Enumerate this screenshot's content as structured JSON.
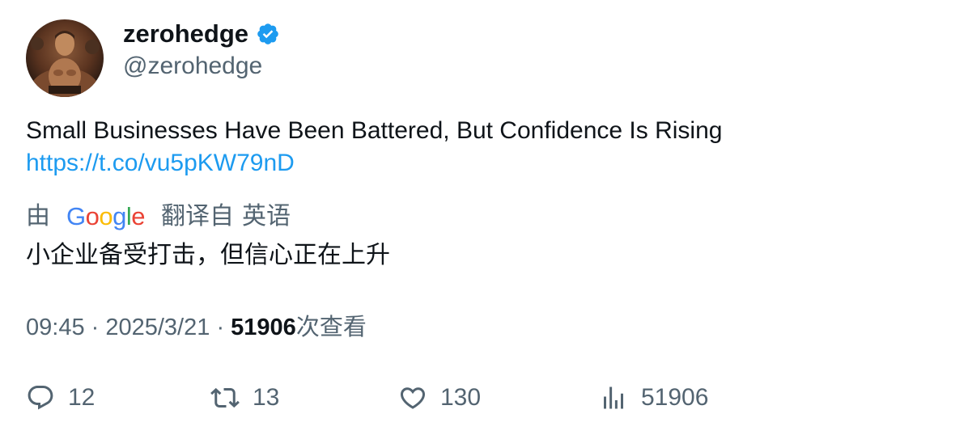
{
  "author": {
    "display_name": "zerohedge",
    "handle": "@zerohedge",
    "verified_icon": "verified-badge-icon",
    "verified_color": "#1d9bf0"
  },
  "tweet": {
    "text": "Small Businesses Have Been Battered, But Confidence Is Rising",
    "link": "https://t.co/vu5pKW79nD"
  },
  "translation": {
    "by_label": "由",
    "provider": "Google",
    "from_label": "翻译自",
    "language": "英语",
    "translated_text": "小企业备受打击，但信心正在上升"
  },
  "meta": {
    "time": "09:45",
    "separator": "·",
    "date": "2025/3/21",
    "views_count": "51906",
    "views_label": "次查看"
  },
  "actions": {
    "reply_count": "12",
    "retweet_count": "13",
    "like_count": "130",
    "views_count": "51906"
  },
  "colors": {
    "link": "#1d9bf0",
    "secondary_text": "#536471",
    "primary_text": "#0f1419"
  }
}
